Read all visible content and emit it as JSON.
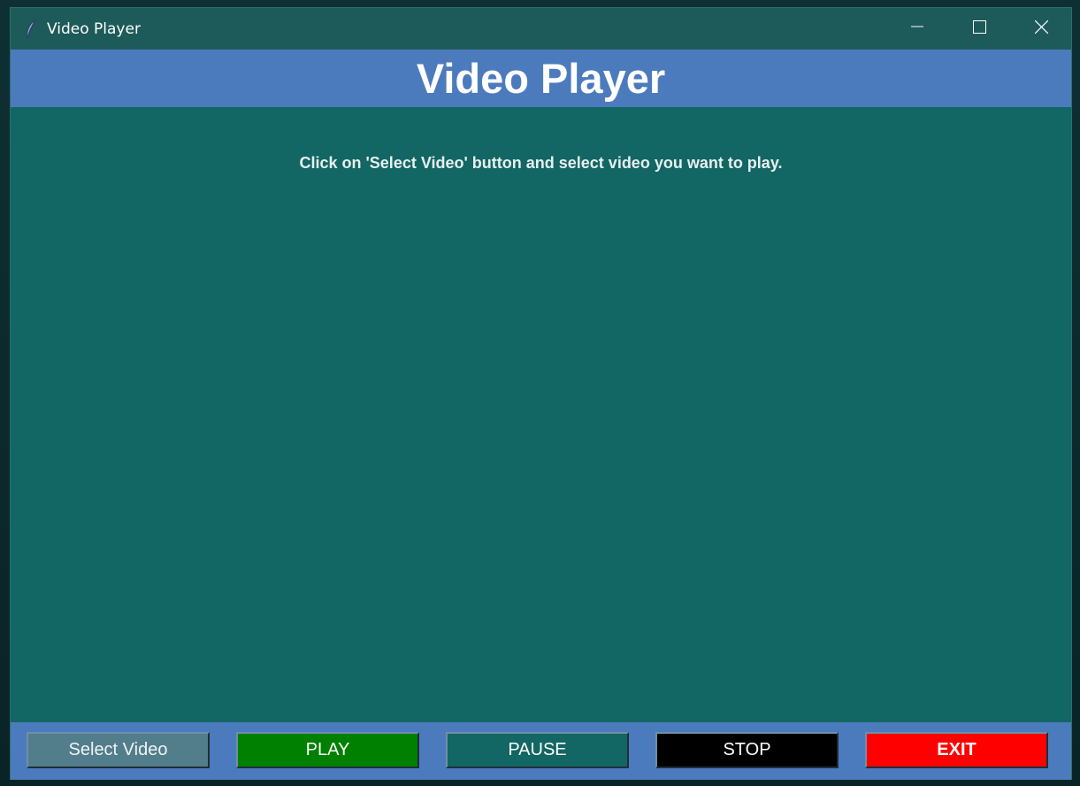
{
  "window": {
    "title": "Video Player"
  },
  "header": {
    "title": "Video Player"
  },
  "main": {
    "instruction": "Click on 'Select Video' button and select video you want to play."
  },
  "controls": {
    "select_label": "Select Video",
    "play_label": "PLAY",
    "pause_label": "PAUSE",
    "stop_label": "STOP",
    "exit_label": "EXIT"
  },
  "colors": {
    "content_bg": "#126664",
    "header_bg": "#4c7bbd",
    "titlebar_bg": "#1d5a5a",
    "play": "#008000",
    "stop": "#000000",
    "exit": "#ff0000",
    "select": "#527d8b"
  },
  "icons": {
    "app": "feather-icon",
    "minimize": "minimize-icon",
    "maximize": "maximize-icon",
    "close": "close-icon"
  }
}
